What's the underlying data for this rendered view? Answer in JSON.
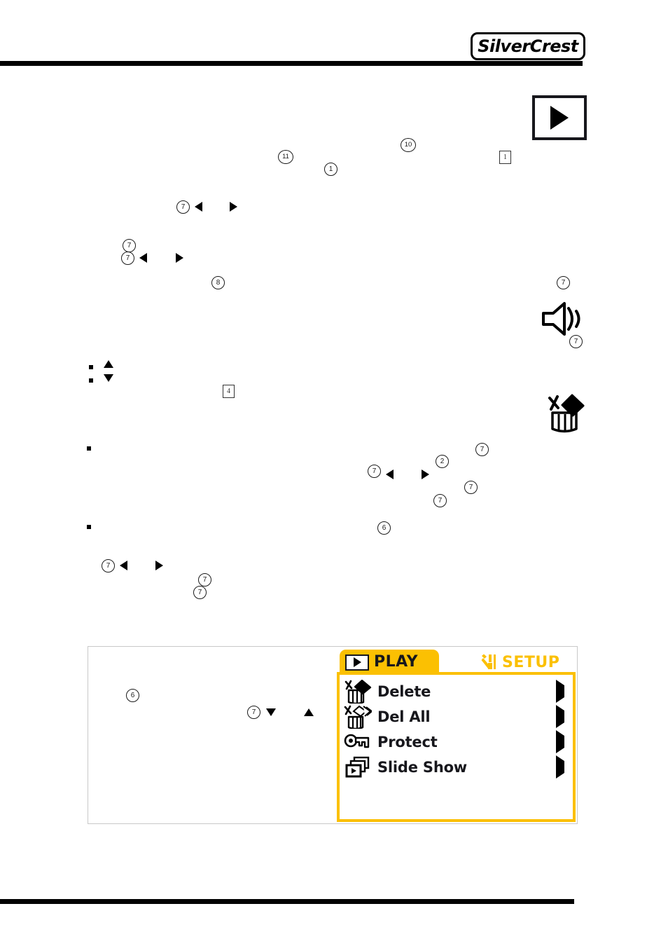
{
  "page": {
    "brand": "SilverCrest",
    "header_rule": true,
    "footer_rule": true
  },
  "margin_icons": [
    {
      "name": "play-icon",
      "label": "play",
      "callout": null
    },
    {
      "name": "speaker-icon",
      "label": "volume",
      "callout": "7"
    },
    {
      "name": "delete-icon",
      "label": "delete",
      "callout": null
    }
  ],
  "callouts": {
    "c1": "1",
    "c2": "2",
    "c4": "4",
    "c6": "6",
    "c7": "7",
    "c8": "8",
    "c10": "10",
    "c11": "11",
    "box1": "1",
    "box4": "4"
  },
  "figure": {
    "tabs": [
      {
        "id": "play",
        "label": "PLAY",
        "icon": "play-icon",
        "active": true
      },
      {
        "id": "setup",
        "label": "SETUP",
        "icon": "tools-icon",
        "active": false
      }
    ],
    "menu_items": [
      {
        "label": "Delete",
        "icon": "delete-one-icon",
        "arrow": "chevron-right-icon"
      },
      {
        "label": "Del All",
        "icon": "delete-all-icon",
        "arrow": "chevron-right-icon"
      },
      {
        "label": "Protect",
        "icon": "key-icon",
        "arrow": "chevron-right-icon"
      },
      {
        "label": "Slide Show",
        "icon": "slide-show-icon",
        "arrow": "chevron-right-icon"
      }
    ]
  },
  "colors": {
    "accent_yellow": "#FBC002",
    "ink": "#17171c",
    "frame_gray": "#c8c8c8"
  }
}
